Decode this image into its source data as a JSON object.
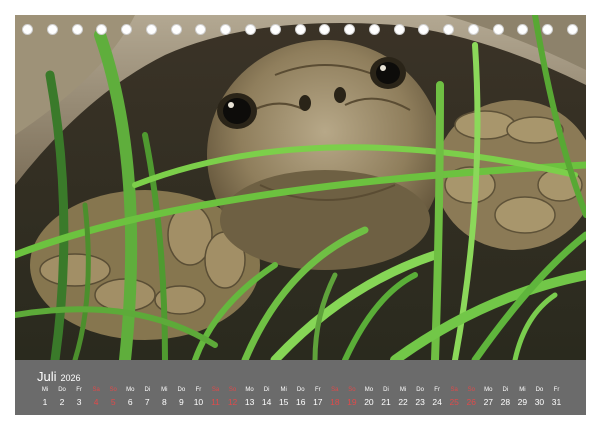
{
  "calendar": {
    "month": "Juli",
    "year": "2026",
    "days": [
      {
        "dn": "Mi",
        "d": "1",
        "we": false
      },
      {
        "dn": "Do",
        "d": "2",
        "we": false
      },
      {
        "dn": "Fr",
        "d": "3",
        "we": false
      },
      {
        "dn": "Sa",
        "d": "4",
        "we": true
      },
      {
        "dn": "So",
        "d": "5",
        "we": true
      },
      {
        "dn": "Mo",
        "d": "6",
        "we": false
      },
      {
        "dn": "Di",
        "d": "7",
        "we": false
      },
      {
        "dn": "Mi",
        "d": "8",
        "we": false
      },
      {
        "dn": "Do",
        "d": "9",
        "we": false
      },
      {
        "dn": "Fr",
        "d": "10",
        "we": false
      },
      {
        "dn": "Sa",
        "d": "11",
        "we": true
      },
      {
        "dn": "So",
        "d": "12",
        "we": true
      },
      {
        "dn": "Mo",
        "d": "13",
        "we": false
      },
      {
        "dn": "Di",
        "d": "14",
        "we": false
      },
      {
        "dn": "Mi",
        "d": "15",
        "we": false
      },
      {
        "dn": "Do",
        "d": "16",
        "we": false
      },
      {
        "dn": "Fr",
        "d": "17",
        "we": false
      },
      {
        "dn": "Sa",
        "d": "18",
        "we": true
      },
      {
        "dn": "So",
        "d": "19",
        "we": true
      },
      {
        "dn": "Mo",
        "d": "20",
        "we": false
      },
      {
        "dn": "Di",
        "d": "21",
        "we": false
      },
      {
        "dn": "Mi",
        "d": "22",
        "we": false
      },
      {
        "dn": "Do",
        "d": "23",
        "we": false
      },
      {
        "dn": "Fr",
        "d": "24",
        "we": false
      },
      {
        "dn": "Sa",
        "d": "25",
        "we": true
      },
      {
        "dn": "So",
        "d": "26",
        "we": true
      },
      {
        "dn": "Mo",
        "d": "27",
        "we": false
      },
      {
        "dn": "Di",
        "d": "28",
        "we": false
      },
      {
        "dn": "Mi",
        "d": "29",
        "we": false
      },
      {
        "dn": "Do",
        "d": "30",
        "we": false
      },
      {
        "dn": "Fr",
        "d": "31",
        "we": false
      }
    ]
  },
  "colors": {
    "bar_background": "#6b6b6b",
    "weekend": "#e04a4a",
    "text": "#ffffff"
  },
  "photo": {
    "subject": "tortoise-in-grass"
  }
}
